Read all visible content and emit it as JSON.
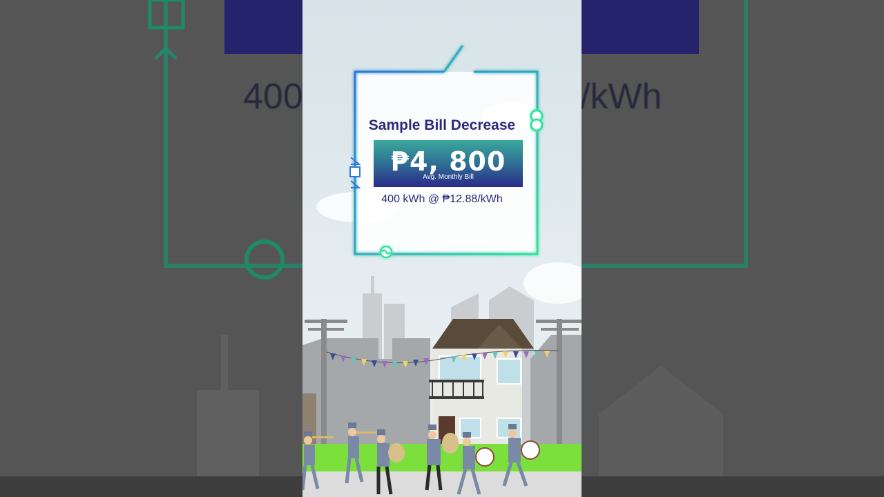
{
  "panel": {
    "title": "Sample Bill Decrease",
    "amount": "₱4, 800",
    "amount_caption": "Avg. Monthly Bill",
    "rate": "400 kWh @ ₱12.88/kWh"
  },
  "background": {
    "left_partial_text": "400",
    "right_partial_text": "/kWh"
  },
  "colors": {
    "title": "#2a2a7a",
    "circuit_glow": "#34e0a0",
    "price_top": "#3aa99c",
    "price_bottom": "#2b2a8a",
    "grass": "#7ce03c",
    "band_uniform": "#7a8aa6"
  }
}
